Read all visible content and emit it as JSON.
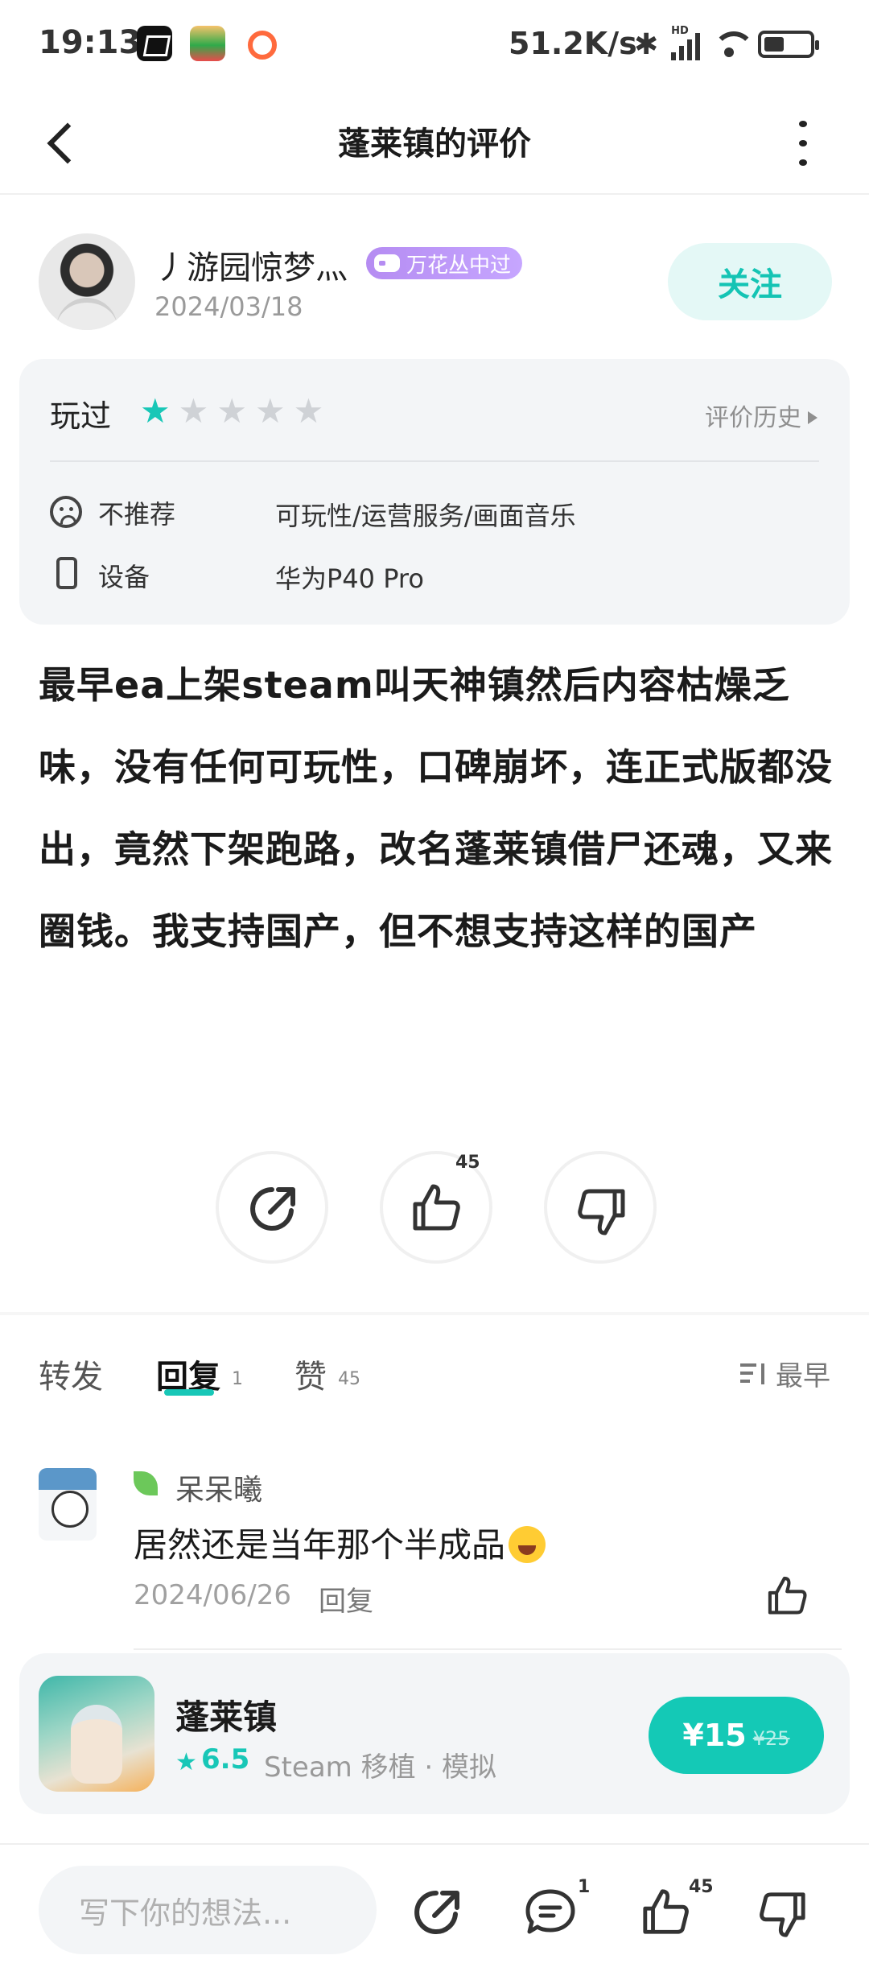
{
  "status_bar": {
    "time": "19:13",
    "network_speed": "51.2K/s",
    "signal_label": "HD",
    "icons": [
      "app-icon",
      "app-icon",
      "app-icon",
      "bluetooth-icon",
      "signal-icon",
      "wifi-icon",
      "battery-icon"
    ]
  },
  "header": {
    "title": "蓬莱镇的评价",
    "icons": [
      "back-icon",
      "more-icon"
    ]
  },
  "author": {
    "name": "丿游园惊梦灬",
    "badge": "万花丛中过",
    "date": "2024/03/18",
    "follow_label": "关注"
  },
  "rating": {
    "status_label": "玩过",
    "stars": 1,
    "max_stars": 5,
    "history_label": "评价历史",
    "rows": [
      {
        "icon": "sad-face-icon",
        "label": "不推荐",
        "value": "可玩性/运营服务/画面音乐"
      },
      {
        "icon": "phone-icon",
        "label": "设备",
        "value": "华为P40 Pro"
      }
    ]
  },
  "review": {
    "text": "最早ea上架steam叫天神镇然后内容枯燥乏味，没有任何可玩性，口碑崩坏，连正式版都没出，竟然下架跑路，改名蓬莱镇借尸还魂，又来圈钱。我支持国产，但不想支持这样的国产"
  },
  "actions": {
    "like_count": "45"
  },
  "tabs": [
    {
      "label": "转发",
      "count": ""
    },
    {
      "label": "回复",
      "count": "1"
    },
    {
      "label": "赞",
      "count": "45"
    }
  ],
  "active_tab": "回复",
  "sort_label": "最早",
  "comment": {
    "user": "呆呆曦",
    "text": "居然还是当年那个半成品",
    "date": "2024/06/26",
    "reply_label": "回复"
  },
  "game": {
    "name": "蓬莱镇",
    "score": "6.5",
    "tags": "Steam 移植 · 模拟",
    "price": "¥15",
    "original_price": "¥25"
  },
  "bottom_bar": {
    "input_placeholder": "写下你的想法...",
    "reply_count": "1",
    "like_count": "45"
  },
  "colors": {
    "accent": "#18c7b7",
    "badge": "#b58cf2",
    "card_bg": "#f3f5f7"
  }
}
